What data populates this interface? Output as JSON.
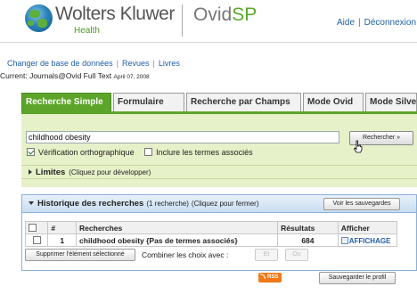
{
  "header": {
    "brand": "Wolters Kluwer",
    "brand_sub": "Health",
    "product": "Ovid",
    "product_accent": "SP",
    "links": [
      "Aide",
      "Déconnexion"
    ]
  },
  "db_links": [
    "Changer de base de données",
    "Revues",
    "Livres"
  ],
  "current_db": {
    "label": "Current: Journals@Ovid Full Text",
    "date": "April 07, 2008"
  },
  "tabs": [
    {
      "label": "Recherche Simple",
      "active": true
    },
    {
      "label": "Formulaire",
      "active": false
    },
    {
      "label": "Recherche par Champs",
      "active": false
    },
    {
      "label": "Mode Ovid",
      "active": false
    },
    {
      "label": "Mode SilverPlatter",
      "active": false
    }
  ],
  "search": {
    "query": "childhood obesity",
    "button": "Rechercher »",
    "spellcheck_label": "Vérification orthographique",
    "spellcheck_checked": true,
    "related_label": "Inclure les termes associés",
    "related_checked": false
  },
  "limits": {
    "label": "Limites",
    "hint": "(Cliquez pour développer)"
  },
  "history": {
    "title": "Historique des recherches",
    "count": "(1 recherche)",
    "hint": "(Cliquez pour fermer)",
    "saved_button": "Voir les sauvegardes",
    "columns": [
      "#",
      "Recherches",
      "Résultats",
      "Afficher"
    ],
    "rows": [
      {
        "num": "1",
        "query": "childhood obesity {Pas de termes associés}",
        "results": "684",
        "display": "AFFICHAGE"
      }
    ],
    "delete_button": "Supprimer l'élément sélectionné",
    "combine_label": "Combiner les choix avec :",
    "and_button": "Et",
    "or_button": "Ou",
    "rss_label": "RSS",
    "save_profile_button": "Sauvegarder le profil"
  },
  "colors": {
    "accent_green": "#5da52a",
    "panel_green": "#e7f1c9",
    "link_blue": "#1f5fa8",
    "history_blue": "#c9ddf1"
  }
}
